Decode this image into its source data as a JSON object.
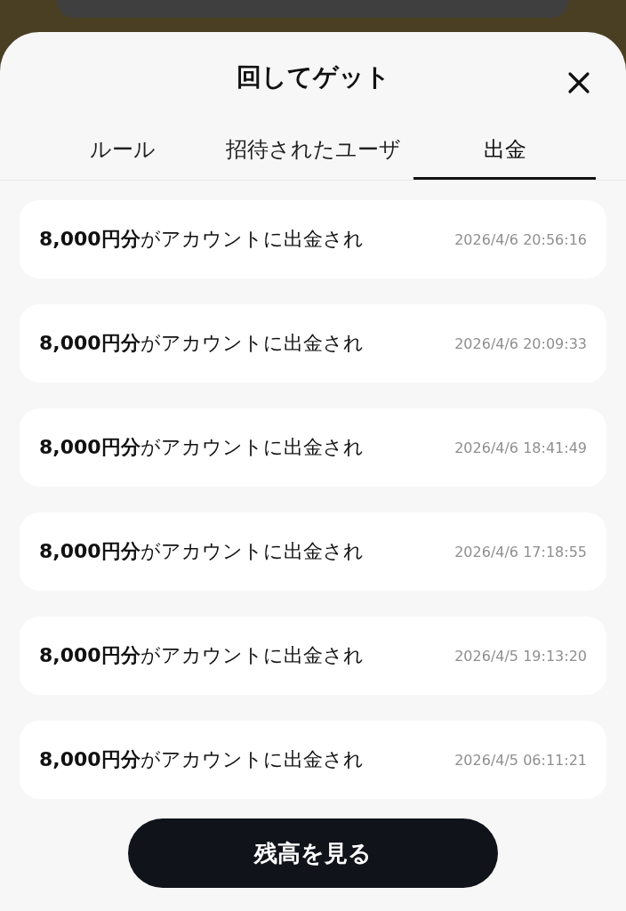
{
  "sheet": {
    "title": "回してゲット"
  },
  "tabs": [
    {
      "label": "ルール",
      "selected": false
    },
    {
      "label": "招待されたユーザ",
      "selected": false
    },
    {
      "label": "出金",
      "selected": true
    }
  ],
  "records": [
    {
      "message": "**8,000円分**がアカウントに出金され",
      "time": "2026/4/6 20:56:16"
    },
    {
      "message": "**8,000円分**がアカウントに出金され",
      "time": "2026/4/6 20:09:33"
    },
    {
      "message": "**8,000円分**がアカウントに出金され",
      "time": "2026/4/6 18:41:49"
    },
    {
      "message": "**8,000円分**がアカウントに出金され",
      "time": "2026/4/6 17:18:55"
    },
    {
      "message": "**8,000円分**がアカウントに出金され",
      "time": "2026/4/5 19:13:20"
    },
    {
      "message": "**8,000円分**がアカウントに出金され",
      "time": "2026/4/5 06:11:21"
    }
  ],
  "button": {
    "label": "残高を見る"
  }
}
